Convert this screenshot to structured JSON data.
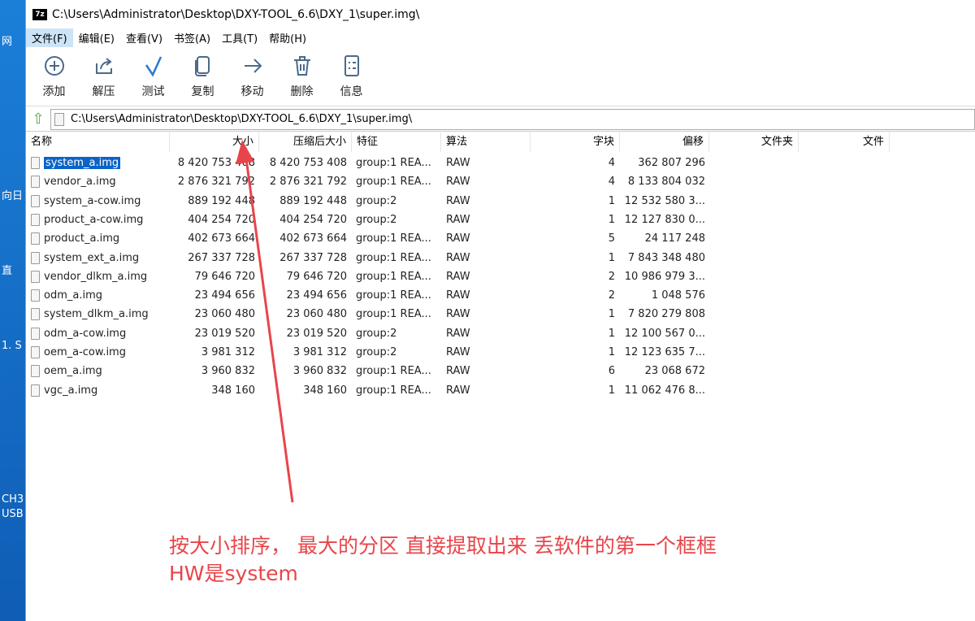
{
  "desktop": {
    "labels": [
      "网",
      "向日",
      "直",
      "1. S",
      "CH3",
      "USB"
    ]
  },
  "window": {
    "title": "C:\\Users\\Administrator\\Desktop\\DXY-TOOL_6.6\\DXY_1\\super.img\\",
    "logo": "7z"
  },
  "menu": [
    "文件(F)",
    "编辑(E)",
    "查看(V)",
    "书签(A)",
    "工具(T)",
    "帮助(H)"
  ],
  "toolbar": [
    {
      "label": "添加",
      "icon": "plus-circle"
    },
    {
      "label": "解压",
      "icon": "extract"
    },
    {
      "label": "测试",
      "icon": "check"
    },
    {
      "label": "复制",
      "icon": "copy"
    },
    {
      "label": "移动",
      "icon": "arrow-right"
    },
    {
      "label": "删除",
      "icon": "trash"
    },
    {
      "label": "信息",
      "icon": "info-list"
    }
  ],
  "address": "C:\\Users\\Administrator\\Desktop\\DXY-TOOL_6.6\\DXY_1\\super.img\\",
  "columns": [
    "名称",
    "大小",
    "压缩后大小",
    "特征",
    "算法",
    "字块",
    "偏移",
    "文件夹",
    "文件"
  ],
  "rows": [
    [
      "system_a.img",
      "8 420 753 408",
      "8 420 753 408",
      "group:1 REA...",
      "RAW",
      "4",
      "362 807 296"
    ],
    [
      "vendor_a.img",
      "2 876 321 792",
      "2 876 321 792",
      "group:1 REA...",
      "RAW",
      "4",
      "8 133 804 032"
    ],
    [
      "system_a-cow.img",
      "889 192 448",
      "889 192 448",
      "group:2",
      "RAW",
      "1",
      "12 532 580 3..."
    ],
    [
      "product_a-cow.img",
      "404 254 720",
      "404 254 720",
      "group:2",
      "RAW",
      "1",
      "12 127 830 0..."
    ],
    [
      "product_a.img",
      "402 673 664",
      "402 673 664",
      "group:1 REA...",
      "RAW",
      "5",
      "24 117 248"
    ],
    [
      "system_ext_a.img",
      "267 337 728",
      "267 337 728",
      "group:1 REA...",
      "RAW",
      "1",
      "7 843 348 480"
    ],
    [
      "vendor_dlkm_a.img",
      "79 646 720",
      "79 646 720",
      "group:1 REA...",
      "RAW",
      "2",
      "10 986 979 3..."
    ],
    [
      "odm_a.img",
      "23 494 656",
      "23 494 656",
      "group:1 REA...",
      "RAW",
      "2",
      "1 048 576"
    ],
    [
      "system_dlkm_a.img",
      "23 060 480",
      "23 060 480",
      "group:1 REA...",
      "RAW",
      "1",
      "7 820 279 808"
    ],
    [
      "odm_a-cow.img",
      "23 019 520",
      "23 019 520",
      "group:2",
      "RAW",
      "1",
      "12 100 567 0..."
    ],
    [
      "oem_a-cow.img",
      "3 981 312",
      "3 981 312",
      "group:2",
      "RAW",
      "1",
      "12 123 635 7..."
    ],
    [
      "oem_a.img",
      "3 960 832",
      "3 960 832",
      "group:1 REA...",
      "RAW",
      "6",
      "23 068 672"
    ],
    [
      "vgc_a.img",
      "348 160",
      "348 160",
      "group:1 REA...",
      "RAW",
      "1",
      "11 062 476 8..."
    ]
  ],
  "annotation": {
    "line1": "按大小排序， 最大的分区 直接提取出来 丢软件的第一个框框",
    "line2": "HW是system",
    "color": "#e8454a"
  }
}
